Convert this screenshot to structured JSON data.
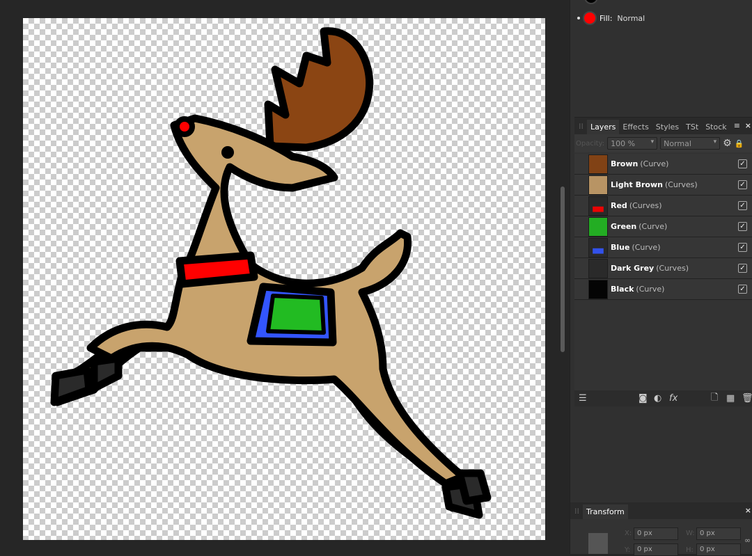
{
  "top_panel": {
    "fill_label": "Fill:",
    "fill_mode": "Normal",
    "fill_color": "#ff0000"
  },
  "layers_panel": {
    "tabs": [
      "Layers",
      "Effects",
      "Styles",
      "TSt",
      "Stock"
    ],
    "opacity_label": "Opacity:",
    "opacity_value": "100 %",
    "blend_mode": "Normal",
    "layers": [
      {
        "name": "Brown",
        "type": "(Curve)",
        "visible": true,
        "thumb_color": "#8b4513"
      },
      {
        "name": "Light Brown",
        "type": "(Curves)",
        "visible": true,
        "thumb_color": "#c8a06a"
      },
      {
        "name": "Red",
        "type": "(Curves)",
        "visible": true,
        "thumb_color": "#ff0000"
      },
      {
        "name": "Green",
        "type": "(Curve)",
        "visible": true,
        "thumb_color": "#22bb22"
      },
      {
        "name": "Blue",
        "type": "(Curve)",
        "visible": true,
        "thumb_color": "#3355ff"
      },
      {
        "name": "Dark Grey",
        "type": "(Curves)",
        "visible": true,
        "thumb_color": "#2a2a2a"
      },
      {
        "name": "Black",
        "type": "(Curve)",
        "visible": true,
        "thumb_color": "#000000"
      }
    ]
  },
  "transform_panel": {
    "title": "Transform",
    "x_label": "X:",
    "x_value": "0 px",
    "y_label": "Y:",
    "y_value": "0 px",
    "w_label": "W:",
    "w_value": "0 px",
    "h_label": "H:",
    "h_value": "0 px"
  },
  "icons": {
    "menu": "hamburger-icon",
    "close": "close-icon",
    "settings": "gear-icon",
    "lock": "lock-icon"
  }
}
